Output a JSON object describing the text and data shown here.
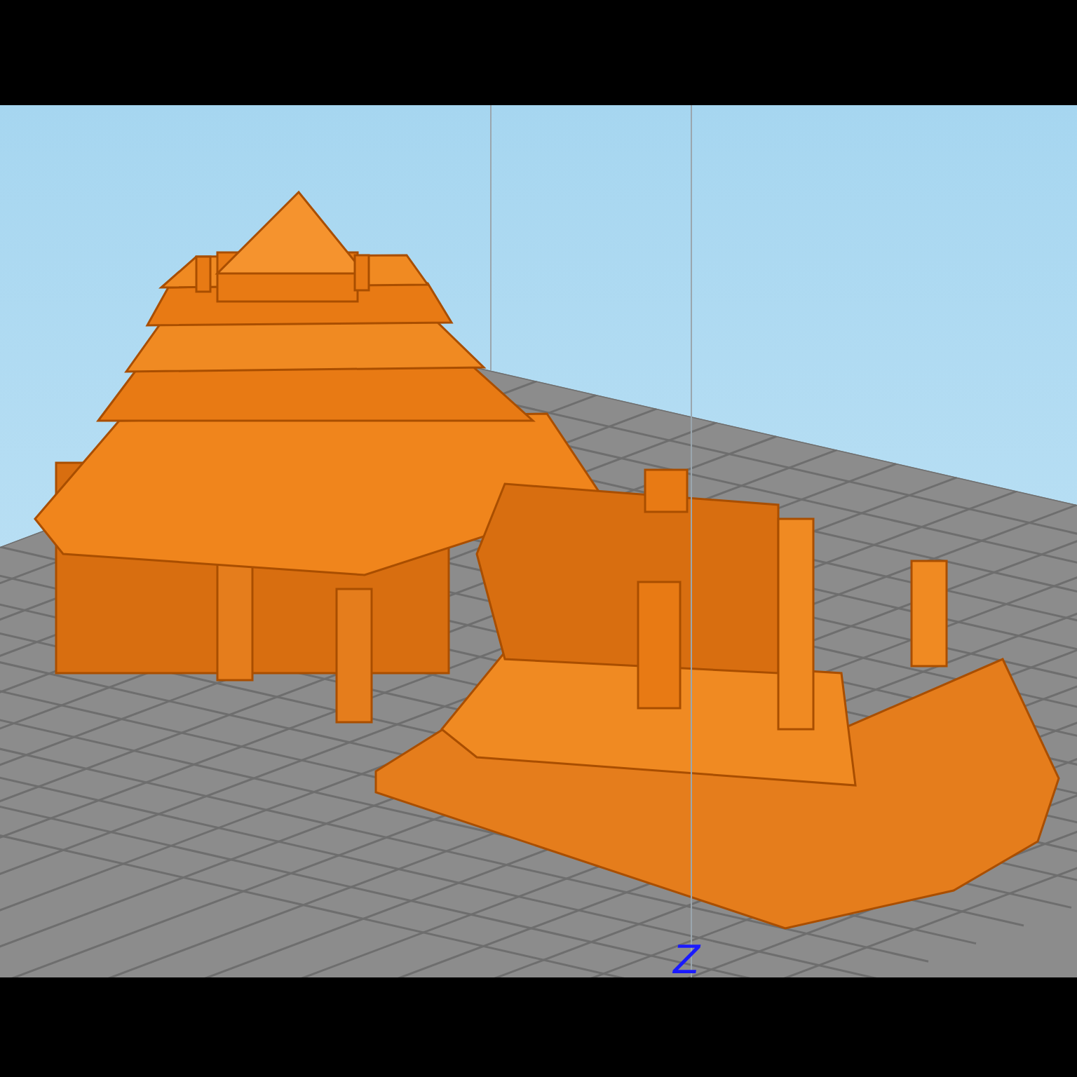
{
  "viewport": {
    "axis_label": "Z"
  }
}
